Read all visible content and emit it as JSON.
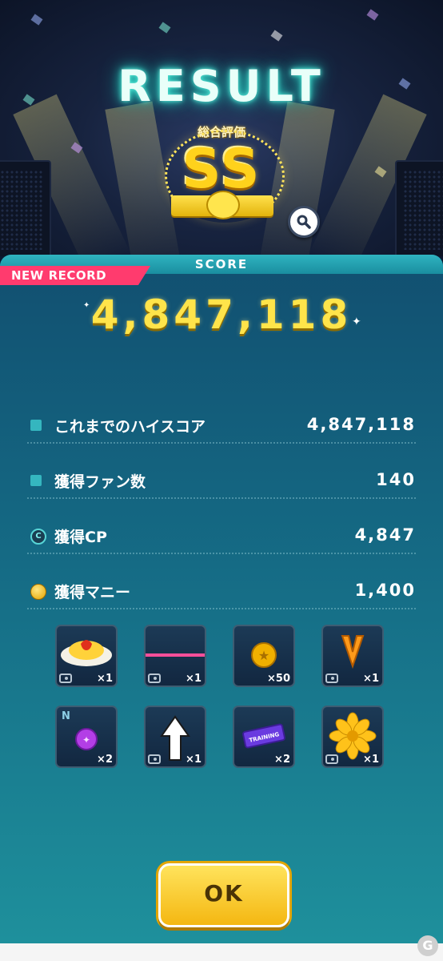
{
  "header": {
    "title": "RESULT",
    "overall_label": "総合評価",
    "rank": "SS"
  },
  "panel": {
    "score_label": "SCORE",
    "new_record_label": "NEW RECORD",
    "score_value": "4,847,118"
  },
  "stats": [
    {
      "label": "これまでのハイスコア",
      "value": "4,847,118",
      "icon": "square-bullet-icon"
    },
    {
      "label": "獲得ファン数",
      "value": "140",
      "icon": "square-bullet-icon"
    },
    {
      "label": "獲得CP",
      "value": "4,847",
      "icon": "cp-coin-icon",
      "icon_text": "C"
    },
    {
      "label": "獲得マニー",
      "value": "1,400",
      "icon": "money-coin-icon"
    }
  ],
  "rewards": [
    {
      "icon": "omurice-icon",
      "qty": "×1"
    },
    {
      "icon": "pink-line-item-icon",
      "qty": "×1"
    },
    {
      "icon": "gold-coin-icon",
      "qty": "×50"
    },
    {
      "icon": "v-letter-icon",
      "qty": "×1"
    },
    {
      "icon": "purple-gem-icon",
      "qty": "×2",
      "grade": "N"
    },
    {
      "icon": "white-arrow-icon",
      "qty": "×1"
    },
    {
      "icon": "training-ticket-icon",
      "qty": "×2",
      "ticket_text": "TRAINING"
    },
    {
      "icon": "yellow-flower-icon",
      "qty": "×1"
    }
  ],
  "ok_button": {
    "label": "OK"
  },
  "watermark": {
    "text": "G"
  },
  "colors": {
    "title_glow": "#29d2c4",
    "rank_gold": "#ffd21c",
    "new_record_pink": "#ff3b6e",
    "score_yellow": "#ffe44a",
    "ok_yellow": "#f4b712"
  }
}
